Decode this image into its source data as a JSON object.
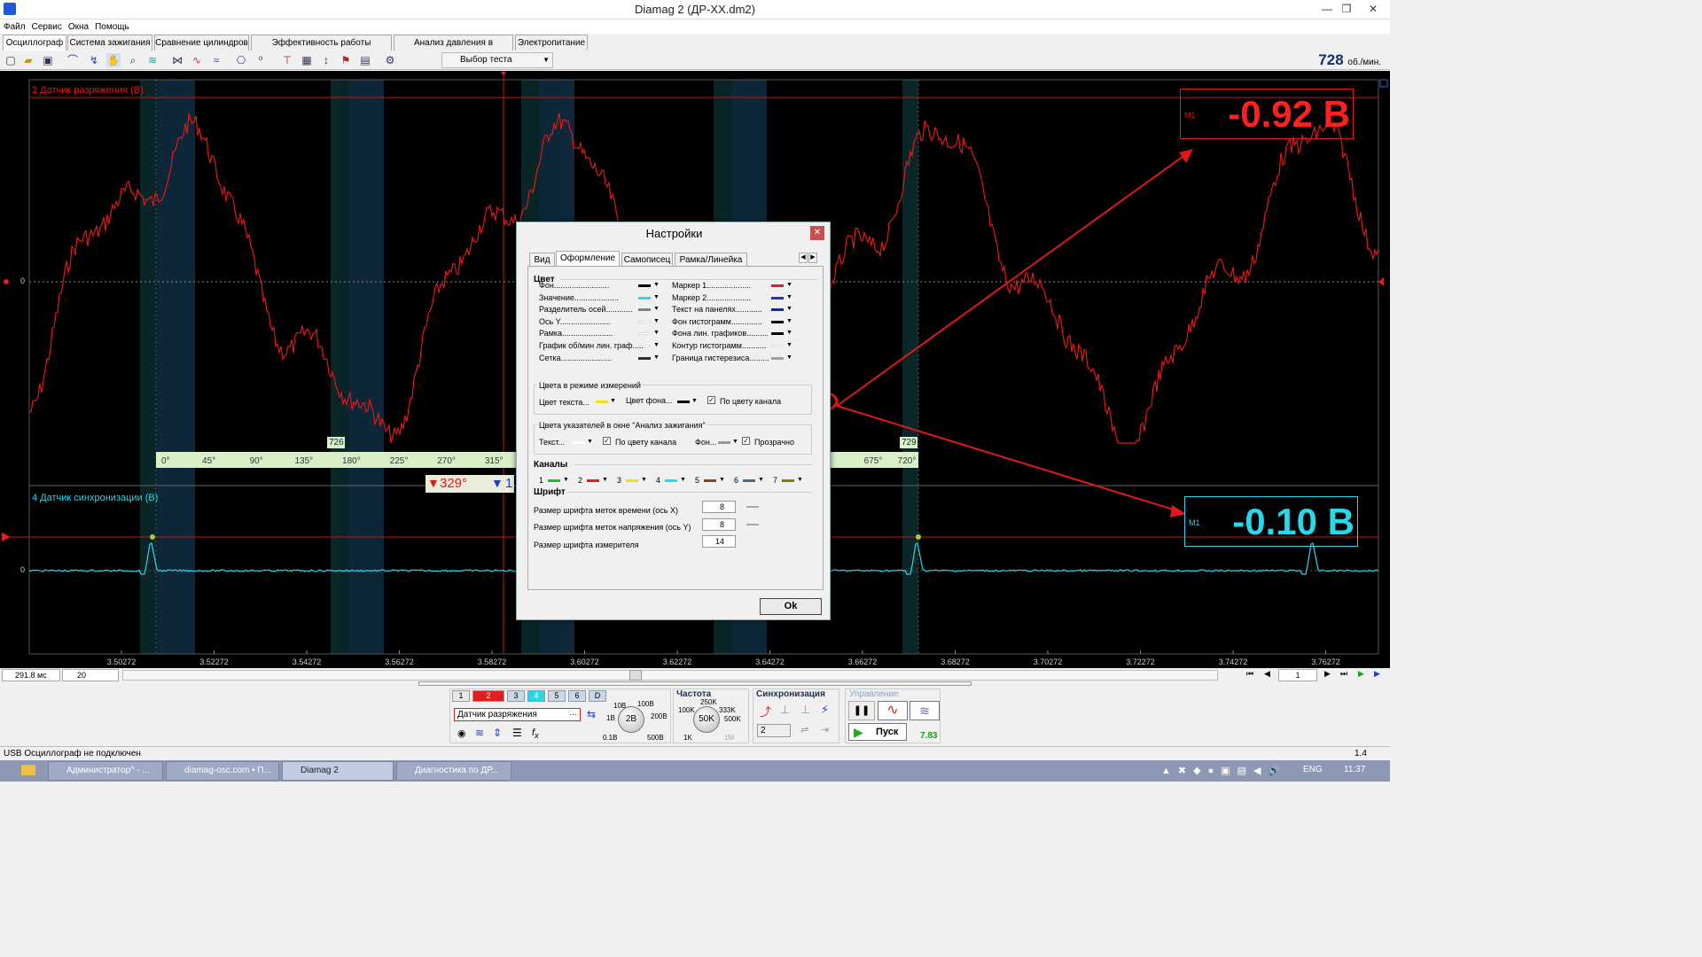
{
  "window": {
    "title": "Diamag 2 (ДР-XX.dm2)",
    "min": "—",
    "max": "❐",
    "close": "✕"
  },
  "menu": [
    "Файл",
    "Сервис",
    "Окна",
    "Помощь"
  ],
  "tabs": [
    "Осциллограф",
    "Система зажигания",
    "Сравнение цилиндров",
    "Эффективность работы цилиндров",
    "Анализ давления в цилиндре",
    "Электропитание"
  ],
  "toolbar": {
    "test_select": "Выбор теста",
    "rpm_value": "728",
    "rpm_unit": "об./мин."
  },
  "scope": {
    "ch2_label": "2 Датчик разряжения (В)",
    "ch4_label": "4 Датчик синхронизации (В)",
    "zero": "0",
    "rpm_left": "726",
    "rpm_right": "729",
    "angle_ticks": [
      "0°",
      "45°",
      "90°",
      "135°",
      "180°",
      "225°",
      "270°",
      "315°"
    ],
    "angle_ticks_right": [
      "675°",
      "720°"
    ],
    "cursor_angle": "329°",
    "cursor2": "1",
    "x_ticks": [
      "3.50272",
      "3.52272",
      "3.54272",
      "3.56272",
      "3.58272",
      "3.60272",
      "3.62272",
      "3.64272",
      "3.66272",
      "3.68272",
      "3.70272",
      "3.72272",
      "3.74272",
      "3.76272"
    ],
    "m1_top": {
      "label": "M1",
      "value": "-0.92 В",
      "color": "#ff2020"
    },
    "m1_bottom": {
      "label": "M1",
      "value": "-0.10 В",
      "color": "#28d8e8"
    }
  },
  "dialog": {
    "title": "Настройки",
    "close": "✕",
    "tabs": [
      "Вид",
      "Оформление",
      "Самописец",
      "Рамка/Линейка"
    ],
    "section_color": "Цвет",
    "colors_left": [
      {
        "label": "Фон",
        "color": "#000000"
      },
      {
        "label": "Значение",
        "color": "#28d8e8"
      },
      {
        "label": "Разделитель осей",
        "color": "#808080"
      },
      {
        "label": "Ось Y",
        "color": "#ffffff"
      },
      {
        "label": "Рамка",
        "color": "#ffffff"
      },
      {
        "label": "График об/мин лин. граф.",
        "color": "#ffffff"
      },
      {
        "label": "Сетка",
        "color": "#303030"
      }
    ],
    "colors_right": [
      {
        "label": "Маркер 1",
        "color": "#e02020"
      },
      {
        "label": "Маркер 2",
        "color": "#2030c0"
      },
      {
        "label": "Текст на панелях",
        "color": "#1b2e80"
      },
      {
        "label": "Фон гистограмм",
        "color": "#000000"
      },
      {
        "label": "Фона лин. графиков",
        "color": "#000000"
      },
      {
        "label": "Контур гистограмм",
        "color": "#ffffff"
      },
      {
        "label": "Граница гистерезиса",
        "color": "#a0a0a0"
      }
    ],
    "measure_group": "Цвета в режиме измерений",
    "measure_text": "Цвет текста...",
    "measure_bg": "Цвет фона...",
    "by_channel": "По цвету канала",
    "pointer_group": "Цвета указателей в окне \"Анализ зажигания\"",
    "pointer_text": "Текст...",
    "pointer_by_channel": "По цвету канала",
    "pointer_bg": "Фон...",
    "transparent": "Прозрачно",
    "channels_title": "Каналы",
    "channels": [
      {
        "n": "1",
        "color": "#20c020"
      },
      {
        "n": "2",
        "color": "#e02020"
      },
      {
        "n": "3",
        "color": "#f0e020"
      },
      {
        "n": "4",
        "color": "#28d8e8"
      },
      {
        "n": "5",
        "color": "#8b4513"
      },
      {
        "n": "6",
        "color": "#4a6a80"
      },
      {
        "n": "7",
        "color": "#808000"
      }
    ],
    "font_title": "Шрифт",
    "font_rows": [
      {
        "label": "Размер шрифта  меток времени (ось X)",
        "value": "8"
      },
      {
        "label": "Размер шрифта  меток напряжения (ось Y)",
        "value": "8"
      },
      {
        "label": "Размер шрифта измерителя",
        "value": "14"
      }
    ],
    "ok": "Ok"
  },
  "bottom": {
    "timebase": "291.8 мс",
    "zoom": "20",
    "page": "1"
  },
  "control": {
    "channels": [
      "1",
      "2",
      "3",
      "4",
      "5",
      "6",
      "D"
    ],
    "sensor": "Датчик разряжения",
    "volt_ticks": [
      "10В",
      "100В",
      "1В",
      "200В",
      "0.1В",
      "500В"
    ],
    "volt_value": "2В",
    "freq_title": "Частота",
    "freq_ticks": [
      "250K",
      "100K",
      "333K",
      "500K",
      "1K",
      "1M"
    ],
    "freq_value": "50K",
    "sync_title": "Синхронизация",
    "sync_channel": "2",
    "ctrl_title": "Управление",
    "start": "Пуск",
    "fps": "7.83"
  },
  "status": {
    "left": "USB Осциллограф не подключен",
    "right": "1.4"
  },
  "taskbar": {
    "items": [
      "Администратор^ - ...",
      "diamag-osc.com • П...",
      "Diamag 2",
      "Диагностика по ДР..."
    ],
    "lang": "ENG",
    "time": "11:37"
  }
}
